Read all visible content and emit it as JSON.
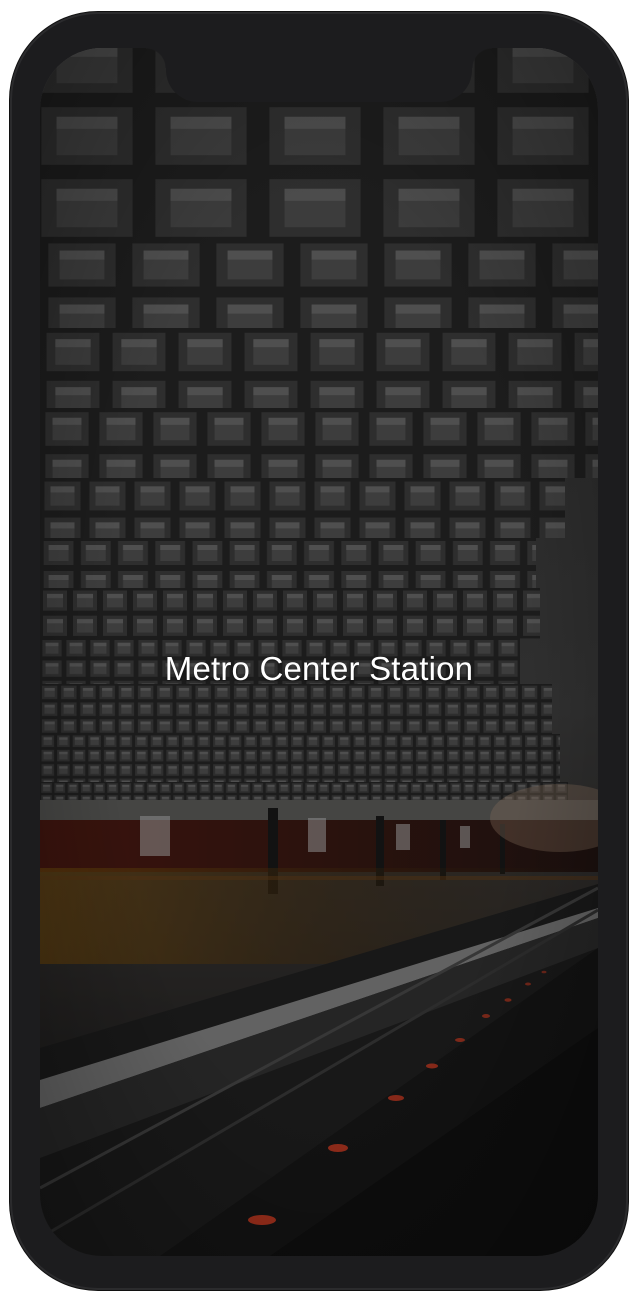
{
  "screen": {
    "station_name": "Metro Center Station",
    "background_image": "metro-station-vaulted-ceiling-photo"
  },
  "colors": {
    "frame": "#1c1c1e",
    "title_text": "#ffffff",
    "platform_light": "#ff4a2a"
  }
}
